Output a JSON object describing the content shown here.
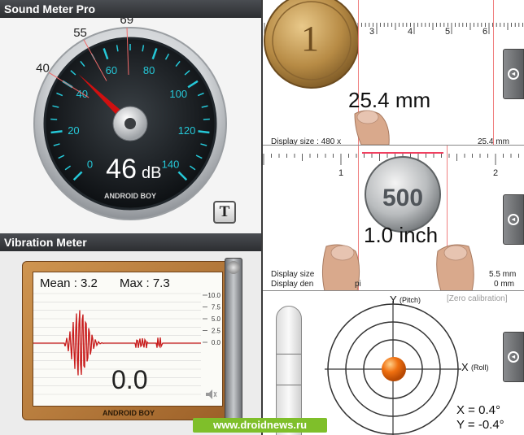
{
  "sound_meter": {
    "title": "Sound Meter Pro",
    "db_value": "46",
    "db_unit": "dB",
    "brand": "ANDROID BOY",
    "t_button": "T",
    "needle_db": 46,
    "gauge_labels": [
      "0",
      "20",
      "40",
      "60",
      "80",
      "100",
      "120",
      "140"
    ],
    "marker_labels": [
      "40",
      "55",
      "69"
    ]
  },
  "vibration_meter": {
    "title": "Vibration Meter",
    "mean_label": "Mean : 3.2",
    "max_label": "Max : 7.3",
    "value": "0.0",
    "brand": "ANDROID BOY",
    "scale_labels": [
      "10.0",
      "7.5",
      "5.0",
      "2.5",
      "0.0"
    ]
  },
  "ruler_top": {
    "tick_labels": [
      "3",
      "4",
      "5",
      "6"
    ],
    "measurement": "25.4 mm",
    "display_size_label": "Display size : 480 x",
    "readout": "25.4 mm"
  },
  "ruler_mid": {
    "tick_labels": [
      "1",
      "2"
    ],
    "measurement": "1.0 inch",
    "display_size_label": "Display size",
    "display_density_label": "Display den",
    "density_suffix": "pi",
    "readout_line1": "5.5 mm",
    "readout_line2": "0 mm"
  },
  "level": {
    "y_label": "Y",
    "y_sub": "(Pitch)",
    "x_label": "X",
    "x_sub": "(Roll)",
    "calibration": "[Zero calibration]",
    "x_value": "X = 0.4°",
    "y_value": "Y = -0.4°"
  },
  "watermark": "www.droidnews.ru",
  "colors": {
    "needle": "#d01010",
    "teal": "#25c8d8",
    "wave": "#c81c1c",
    "wood": "#b87a3a",
    "ball": "#f07010",
    "watermark_bg": "#7fbf2a"
  }
}
